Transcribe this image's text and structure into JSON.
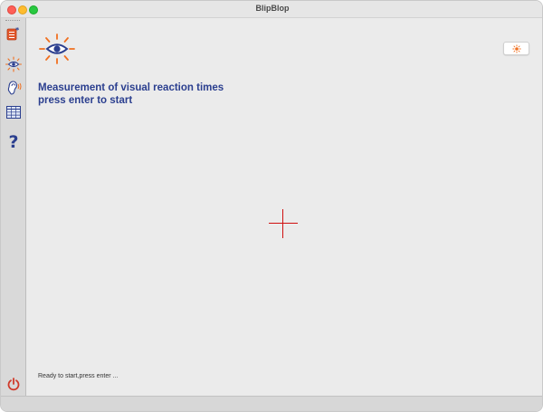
{
  "window": {
    "title": "BlipBlop"
  },
  "sidebar": {
    "items": [
      {
        "icon": "notes-icon"
      },
      {
        "icon": "eye-icon"
      },
      {
        "icon": "ear-icon"
      },
      {
        "icon": "table-icon"
      },
      {
        "icon": "help-icon"
      }
    ],
    "power_icon": "power-icon"
  },
  "main": {
    "heading_line1": "Measurement of visual reaction times",
    "heading_line2": "press enter to start",
    "status": "Ready to start,press enter ...",
    "settings_icon": "sun-icon"
  },
  "colors": {
    "accent_blue": "#2b3f8f",
    "accent_orange": "#f07020",
    "crosshair_red": "#d01010",
    "power_red": "#d03a2a"
  }
}
